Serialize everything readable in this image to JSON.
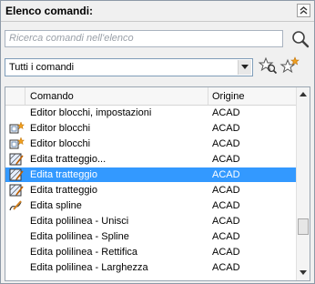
{
  "panel": {
    "title": "Elenco comandi:",
    "search_placeholder": "Ricerca comandi nell'elenco",
    "filter_selected": "Tutti i comandi"
  },
  "list": {
    "columns": [
      "Comando",
      "Origine"
    ],
    "selected_index": 4,
    "rows": [
      {
        "command": "Editor blocchi, impostazioni",
        "origin": "ACAD",
        "icon": ""
      },
      {
        "command": "Editor blocchi",
        "origin": "ACAD",
        "icon": "block-editor-icon"
      },
      {
        "command": "Editor blocchi",
        "origin": "ACAD",
        "icon": "block-editor-icon"
      },
      {
        "command": "Edita tratteggio...",
        "origin": "ACAD",
        "icon": "edit-hatch-icon"
      },
      {
        "command": "Edita tratteggio",
        "origin": "ACAD",
        "icon": "edit-hatch-icon"
      },
      {
        "command": "Edita tratteggio",
        "origin": "ACAD",
        "icon": "edit-hatch-icon"
      },
      {
        "command": "Edita spline",
        "origin": "ACAD",
        "icon": "edit-spline-icon"
      },
      {
        "command": "Edita polilinea - Unisci",
        "origin": "ACAD",
        "icon": ""
      },
      {
        "command": "Edita polilinea - Spline",
        "origin": "ACAD",
        "icon": ""
      },
      {
        "command": "Edita polilinea - Rettifica",
        "origin": "ACAD",
        "icon": ""
      },
      {
        "command": "Edita polilinea - Larghezza",
        "origin": "ACAD",
        "icon": ""
      }
    ]
  },
  "colors": {
    "selection": "#3399ff",
    "accent_star": "#f0a020"
  }
}
